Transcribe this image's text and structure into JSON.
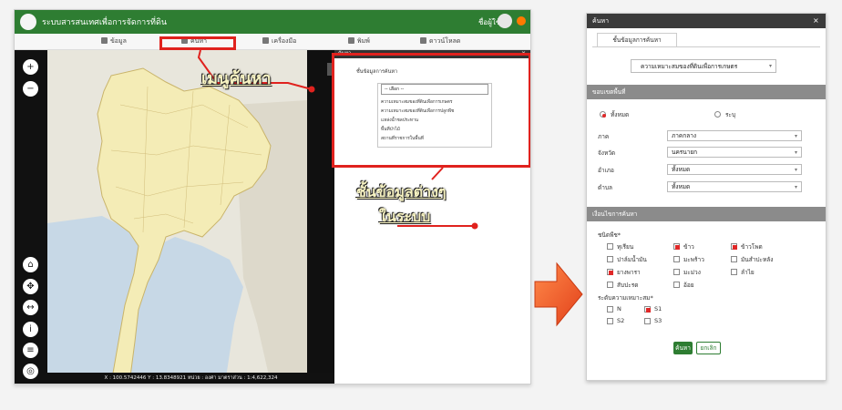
{
  "app": {
    "title": "ระบบสารสนเทศเพื่อการจัดการที่ดิน",
    "user_name": "ชื่อผู้ใช้"
  },
  "menu": {
    "items": [
      {
        "id": "data",
        "label": "ข้อมูล"
      },
      {
        "id": "search",
        "label": "ค้นหา"
      },
      {
        "id": "measure",
        "label": "เครื่องมือ"
      },
      {
        "id": "print",
        "label": "พิมพ์"
      },
      {
        "id": "download",
        "label": "ดาวน์โหลด"
      }
    ]
  },
  "map": {
    "zoom_in": "+",
    "zoom_out": "−",
    "status_text": "X : 100.5742446  Y : 13.8348921  หน่วย : องศา  มาตราส่วน : 1:4,622,324"
  },
  "search_panel": {
    "header": "ค้นหา",
    "layer_title": "ชั้นข้อมูลการค้นหา",
    "select_placeholder": "-- เลือก --",
    "layers": [
      "ความเหมาะสมของที่ดินเพื่อการเกษตร",
      "ความเหมาะสมของที่ดินเพื่อการปลูกพืช",
      "แหล่งน้ำชลประทาน",
      "พื้นที่ป่าไม้",
      "สถานที่ราชการในพื้นที่"
    ]
  },
  "callouts": {
    "search_menu": "เมนูค้นหา",
    "layers_line1": "ชั้นข้อมูลต่างๆ",
    "layers_line2": "ในระบบ"
  },
  "dialog": {
    "header": "ค้นหา",
    "close": "×",
    "tab_label": "ชั้นข้อมูลการค้นหา",
    "layer_value": "ความเหมาะสมของที่ดินเพื่อการเกษตร",
    "section_area": "ขอบเขตพื้นที่",
    "radio_all": "ทั้งหมด",
    "radio_custom": "ระบุ",
    "fields": [
      {
        "label": "ภาค",
        "value": "ภาคกลาง"
      },
      {
        "label": "จังหวัด",
        "value": "นครนายก"
      },
      {
        "label": "อำเภอ",
        "value": "ทั้งหมด"
      },
      {
        "label": "ตำบล",
        "value": "ทั้งหมด"
      }
    ],
    "section_filter": "เงื่อนไขการค้นหา",
    "filter_label": "ชนิดพืช*",
    "crops": [
      {
        "label": "ทุเรียน",
        "checked": false
      },
      {
        "label": "ข้าว",
        "checked": true
      },
      {
        "label": "ข้าวโพด",
        "checked": true
      },
      {
        "label": "ปาล์มน้ำมัน",
        "checked": false
      },
      {
        "label": "มะพร้าว",
        "checked": false
      },
      {
        "label": "มันสำปะหลัง",
        "checked": false
      },
      {
        "label": "ยางพารา",
        "checked": true
      },
      {
        "label": "มะม่วง",
        "checked": false
      },
      {
        "label": "ลำไย",
        "checked": false
      },
      {
        "label": "สับปะรด",
        "checked": false
      },
      {
        "label": "อ้อย",
        "checked": false
      }
    ],
    "suitability_label": "ระดับความเหมาะสม*",
    "levels": [
      {
        "label": "N",
        "checked": false
      },
      {
        "label": "S1",
        "checked": true
      },
      {
        "label": "S2",
        "checked": false
      },
      {
        "label": "S3",
        "checked": false
      }
    ],
    "search_button": "ค้นหา",
    "cancel_button": "ยกเลิก"
  },
  "colors": {
    "brand_green": "#2e7d32",
    "highlight_red": "#e0221e",
    "callout_text": "#f7f3c2",
    "arrow_orange": "#f0531e"
  }
}
